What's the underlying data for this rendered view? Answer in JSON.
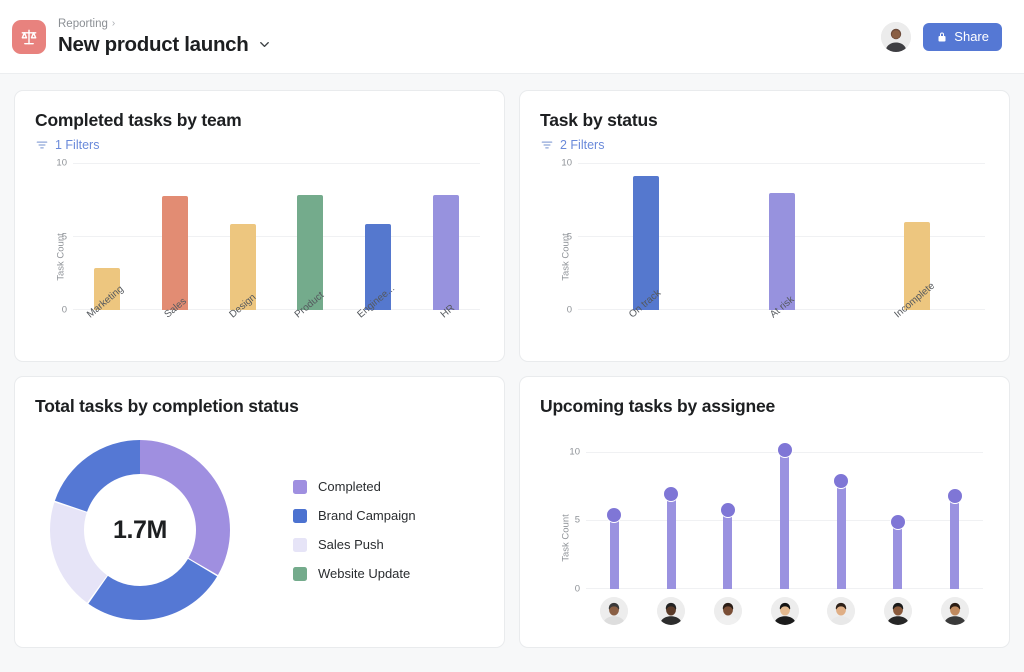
{
  "header": {
    "project_icon": "scales-icon",
    "project_icon_color": "#e8827e",
    "breadcrumb_parent": "Reporting",
    "breadcrumb_separator": "›",
    "title": "New product launch",
    "title_caret": "chevron-down-icon",
    "share_label": "Share",
    "share_icon": "lock-icon",
    "share_color": "#5578d4",
    "avatar": "user-avatar"
  },
  "cards": {
    "completed_by_team": {
      "title": "Completed tasks by team",
      "filters_label": "1 Filters",
      "filters_icon": "filter-icon"
    },
    "task_by_status": {
      "title": "Task by status",
      "filters_label": "2 Filters",
      "filters_icon": "filter-icon"
    },
    "total_by_completion": {
      "title": "Total tasks by completion status",
      "center_value": "1.7M"
    },
    "upcoming_by_assignee": {
      "title": "Upcoming tasks by assignee"
    }
  },
  "chart_data": [
    {
      "type": "bar",
      "title": "Completed tasks by team",
      "xlabel": "",
      "ylabel": "Task Count",
      "categories": [
        "Marketing",
        "Sales",
        "Design",
        "Product",
        "Enginee...",
        "HR"
      ],
      "values": [
        2.9,
        7.8,
        5.9,
        7.9,
        5.9,
        7.9
      ],
      "colors": [
        "#edc67f",
        "#e28c73",
        "#edc67f",
        "#74ab8c",
        "#5578ce",
        "#9792de"
      ],
      "ylim": [
        0,
        10
      ],
      "yticks": [
        0,
        5,
        10
      ],
      "grid": true,
      "legend": "none"
    },
    {
      "type": "bar",
      "title": "Task by status",
      "xlabel": "",
      "ylabel": "Task Count",
      "categories": [
        "On track",
        "At risk",
        "Incomplete"
      ],
      "values": [
        9.2,
        8.0,
        6.0
      ],
      "colors": [
        "#5578ce",
        "#9792de",
        "#edc67f"
      ],
      "ylim": [
        0,
        10
      ],
      "yticks": [
        0,
        5,
        10
      ],
      "grid": true,
      "legend": "none"
    },
    {
      "type": "pie",
      "title": "Total tasks by completion status",
      "center_value": "1.7M",
      "labels": [
        "Completed",
        "Brand Campaign",
        "Sales Push",
        "Website Update"
      ],
      "legend_colors": [
        "#9f8fe0",
        "#4c72d0",
        "#e6e4f7",
        "#74ab8c"
      ],
      "slices": [
        {
          "label": "Completed",
          "value": 33,
          "color": "#9f8fe0",
          "start_deg": 0,
          "end_deg": 120
        },
        {
          "label": "Brand Campaign",
          "value": 26,
          "color": "#5578d4",
          "start_deg": 121,
          "end_deg": 215
        },
        {
          "label": "Sales Push",
          "value": 20,
          "color": "#e6e4f7",
          "start_deg": 216,
          "end_deg": 288
        },
        {
          "label": "Brand Campaign",
          "value": 19,
          "color": "#5578d4",
          "start_deg": 289,
          "end_deg": 360
        }
      ],
      "legend_position": "right",
      "donut": true
    },
    {
      "type": "scatter",
      "title": "Upcoming tasks by assignee",
      "xlabel": "",
      "ylabel": "Task Count",
      "categories": [
        "assignee-1",
        "assignee-2",
        "assignee-3",
        "assignee-4",
        "assignee-5",
        "assignee-6",
        "assignee-7"
      ],
      "values": [
        5.4,
        7.0,
        5.8,
        10.2,
        7.9,
        4.9,
        6.8
      ],
      "stem_color": "#9a92e0",
      "dot_color": "#7f76d6",
      "ylim": [
        0,
        11
      ],
      "yticks": [
        0,
        5,
        10
      ],
      "grid": true,
      "legend": "none"
    }
  ]
}
